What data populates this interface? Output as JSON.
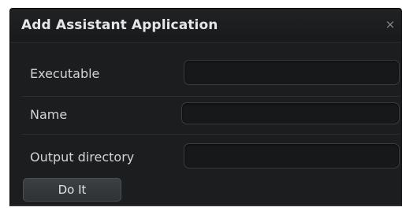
{
  "dialog": {
    "title": "Add Assistant Application",
    "close_glyph": "×",
    "close_icon": "close-icon",
    "fields": [
      {
        "label": "Executable",
        "value": "",
        "placeholder": ""
      },
      {
        "label": "Name",
        "value": "",
        "placeholder": ""
      },
      {
        "label": "Output directory",
        "value": "",
        "placeholder": ""
      }
    ],
    "submit_label": "Do It"
  }
}
